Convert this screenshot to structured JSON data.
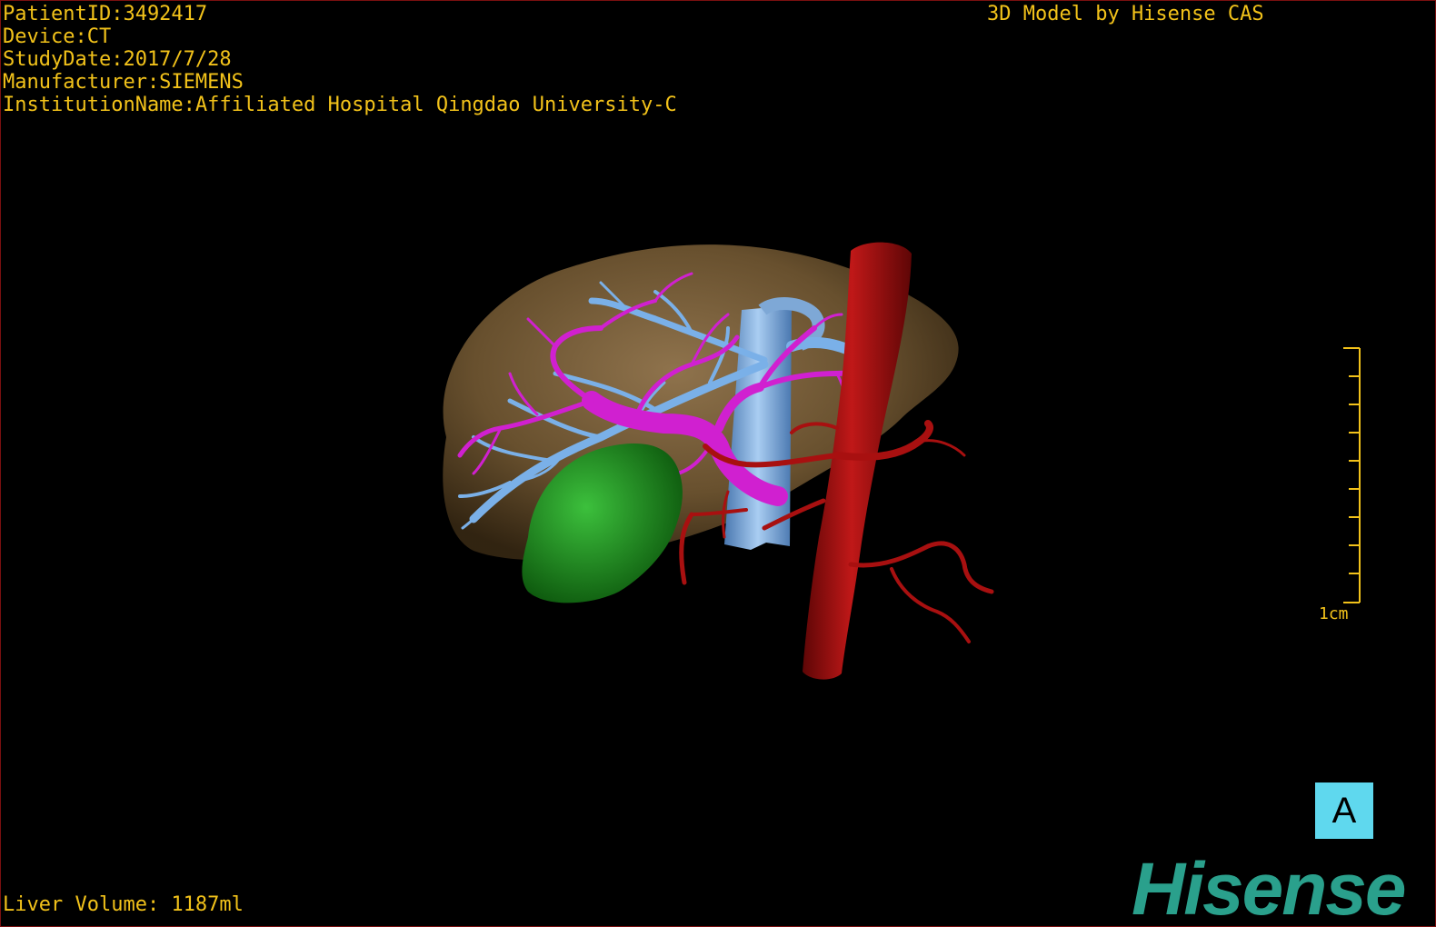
{
  "header": {
    "patient_id": "PatientID:3492417",
    "device": "Device:CT",
    "study_date": "StudyDate:2017/7/28",
    "manufacturer": "Manufacturer:SIEMENS",
    "institution": "InstitutionName:Affiliated Hospital Qingdao University-C",
    "brand_title": "3D Model by Hisense CAS"
  },
  "footer": {
    "liver_volume": "Liver Volume: 1187ml"
  },
  "scale_bar": {
    "label": "1cm"
  },
  "orientation": {
    "label": "A"
  },
  "logo": {
    "text": "Hisense"
  },
  "colors": {
    "text": "#f2c21a",
    "liver": "#8a6a3c",
    "portal_vein": "#d020d0",
    "hepatic_vein": "#7ab0e8",
    "artery": "#a81010",
    "gallbladder": "#1e8a1e",
    "orientation_box": "#5fd8ee",
    "logo": "#2aa08c"
  }
}
